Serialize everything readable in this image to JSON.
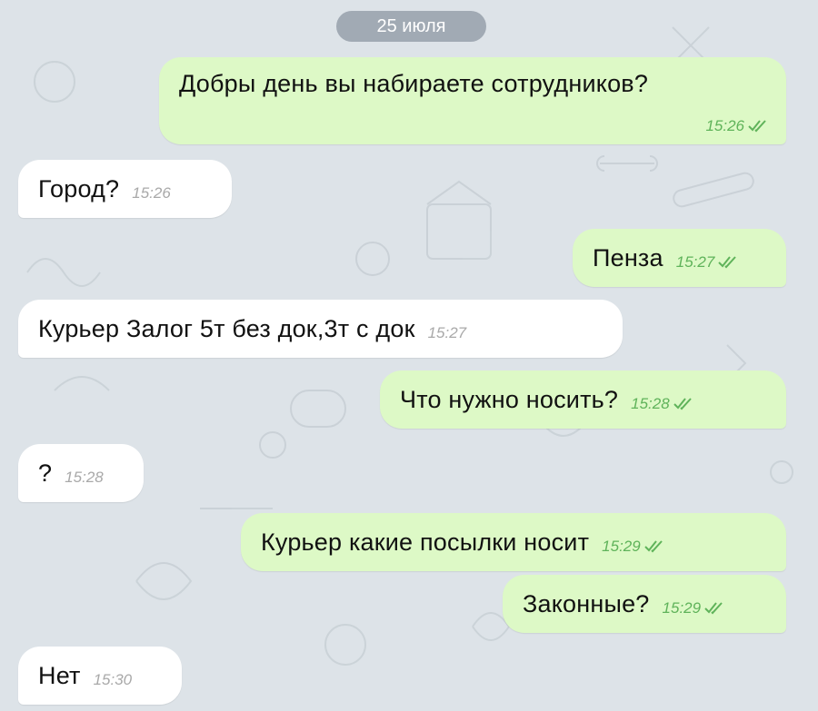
{
  "date_label": "25 июля",
  "colors": {
    "background": "#dde3e8",
    "incoming_bubble": "#ffffff",
    "outgoing_bubble": "#ddf9c6",
    "read_check": "#5fb35a",
    "incoming_time": "#a9a9a9",
    "date_pill": "#96a0aa"
  },
  "messages": [
    {
      "direction": "outgoing",
      "text": "Добры день вы набираете сотрудников?",
      "time": "15:26",
      "status_icon": "double-check-icon"
    },
    {
      "direction": "incoming",
      "text": "Город?",
      "time": "15:26"
    },
    {
      "direction": "outgoing",
      "text": "Пенза",
      "time": "15:27",
      "status_icon": "double-check-icon"
    },
    {
      "direction": "incoming",
      "text": "Курьер Залог 5т без док,3т с док",
      "time": "15:27"
    },
    {
      "direction": "outgoing",
      "text": "Что нужно носить?",
      "time": "15:28",
      "status_icon": "double-check-icon"
    },
    {
      "direction": "incoming",
      "text": "?",
      "time": "15:28"
    },
    {
      "direction": "outgoing",
      "text": "Курьер какие посылки носит",
      "time": "15:29",
      "status_icon": "double-check-icon"
    },
    {
      "direction": "outgoing",
      "text": "Законные?",
      "time": "15:29",
      "status_icon": "double-check-icon"
    },
    {
      "direction": "incoming",
      "text": "Нет",
      "time": "15:30"
    }
  ]
}
